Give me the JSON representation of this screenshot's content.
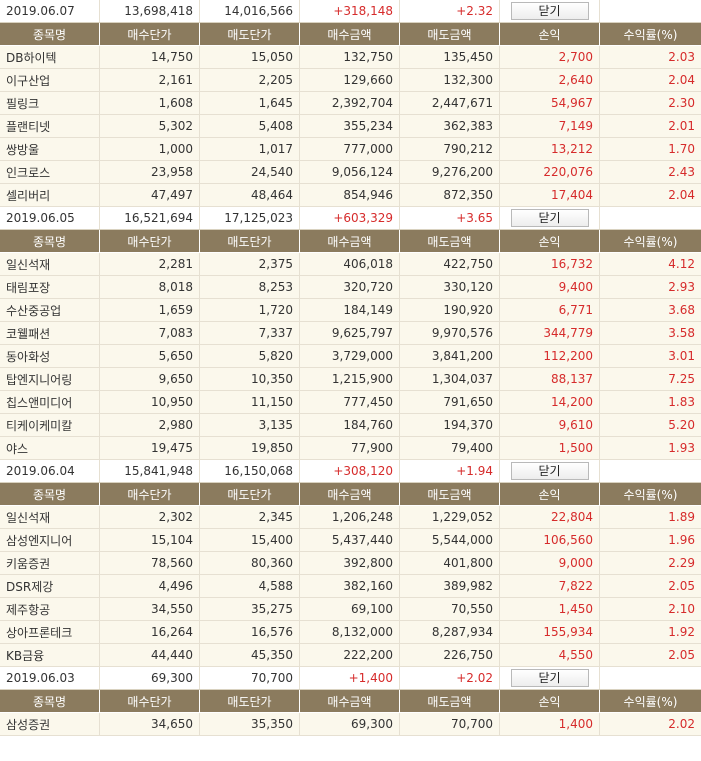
{
  "headers": [
    "종목명",
    "매수단가",
    "매도단가",
    "매수금액",
    "매도금액",
    "손익",
    "수익률(%)"
  ],
  "colors": {
    "header_bg": "#8b7b5e",
    "row_bg": "#fbf8ec",
    "profit": "#d62b2b"
  },
  "groups": [
    {
      "summary": {
        "date": "2019.06.07",
        "buy_total": "13,698,418",
        "sell_total": "14,016,566",
        "profit": "+318,148",
        "rate": "+2.32",
        "close_label": "닫기"
      },
      "rows": [
        [
          "DB하이텍",
          "14,750",
          "15,050",
          "132,750",
          "135,450",
          "2,700",
          "2.03"
        ],
        [
          "이구산업",
          "2,161",
          "2,205",
          "129,660",
          "132,300",
          "2,640",
          "2.04"
        ],
        [
          "필링크",
          "1,608",
          "1,645",
          "2,392,704",
          "2,447,671",
          "54,967",
          "2.30"
        ],
        [
          "플랜티넷",
          "5,302",
          "5,408",
          "355,234",
          "362,383",
          "7,149",
          "2.01"
        ],
        [
          "쌍방울",
          "1,000",
          "1,017",
          "777,000",
          "790,212",
          "13,212",
          "1.70"
        ],
        [
          "인크로스",
          "23,958",
          "24,540",
          "9,056,124",
          "9,276,200",
          "220,076",
          "2.43"
        ],
        [
          "셀리버리",
          "47,497",
          "48,464",
          "854,946",
          "872,350",
          "17,404",
          "2.04"
        ]
      ]
    },
    {
      "summary": {
        "date": "2019.06.05",
        "buy_total": "16,521,694",
        "sell_total": "17,125,023",
        "profit": "+603,329",
        "rate": "+3.65",
        "close_label": "닫기"
      },
      "rows": [
        [
          "일신석재",
          "2,281",
          "2,375",
          "406,018",
          "422,750",
          "16,732",
          "4.12"
        ],
        [
          "태림포장",
          "8,018",
          "8,253",
          "320,720",
          "330,120",
          "9,400",
          "2.93"
        ],
        [
          "수산중공업",
          "1,659",
          "1,720",
          "184,149",
          "190,920",
          "6,771",
          "3.68"
        ],
        [
          "코웰패션",
          "7,083",
          "7,337",
          "9,625,797",
          "9,970,576",
          "344,779",
          "3.58"
        ],
        [
          "동아화성",
          "5,650",
          "5,820",
          "3,729,000",
          "3,841,200",
          "112,200",
          "3.01"
        ],
        [
          "탑엔지니어링",
          "9,650",
          "10,350",
          "1,215,900",
          "1,304,037",
          "88,137",
          "7.25"
        ],
        [
          "칩스앤미디어",
          "10,950",
          "11,150",
          "777,450",
          "791,650",
          "14,200",
          "1.83"
        ],
        [
          "티케이케미칼",
          "2,980",
          "3,135",
          "184,760",
          "194,370",
          "9,610",
          "5.20"
        ],
        [
          "야스",
          "19,475",
          "19,850",
          "77,900",
          "79,400",
          "1,500",
          "1.93"
        ]
      ]
    },
    {
      "summary": {
        "date": "2019.06.04",
        "buy_total": "15,841,948",
        "sell_total": "16,150,068",
        "profit": "+308,120",
        "rate": "+1.94",
        "close_label": "닫기"
      },
      "rows": [
        [
          "일신석재",
          "2,302",
          "2,345",
          "1,206,248",
          "1,229,052",
          "22,804",
          "1.89"
        ],
        [
          "삼성엔지니어",
          "15,104",
          "15,400",
          "5,437,440",
          "5,544,000",
          "106,560",
          "1.96"
        ],
        [
          "키움증권",
          "78,560",
          "80,360",
          "392,800",
          "401,800",
          "9,000",
          "2.29"
        ],
        [
          "DSR제강",
          "4,496",
          "4,588",
          "382,160",
          "389,982",
          "7,822",
          "2.05"
        ],
        [
          "제주항공",
          "34,550",
          "35,275",
          "69,100",
          "70,550",
          "1,450",
          "2.10"
        ],
        [
          "상아프론테크",
          "16,264",
          "16,576",
          "8,132,000",
          "8,287,934",
          "155,934",
          "1.92"
        ],
        [
          "KB금융",
          "44,440",
          "45,350",
          "222,200",
          "226,750",
          "4,550",
          "2.05"
        ]
      ]
    },
    {
      "summary": {
        "date": "2019.06.03",
        "buy_total": "69,300",
        "sell_total": "70,700",
        "profit": "+1,400",
        "rate": "+2.02",
        "close_label": "닫기"
      },
      "rows": [
        [
          "삼성증권",
          "34,650",
          "35,350",
          "69,300",
          "70,700",
          "1,400",
          "2.02"
        ]
      ]
    }
  ]
}
